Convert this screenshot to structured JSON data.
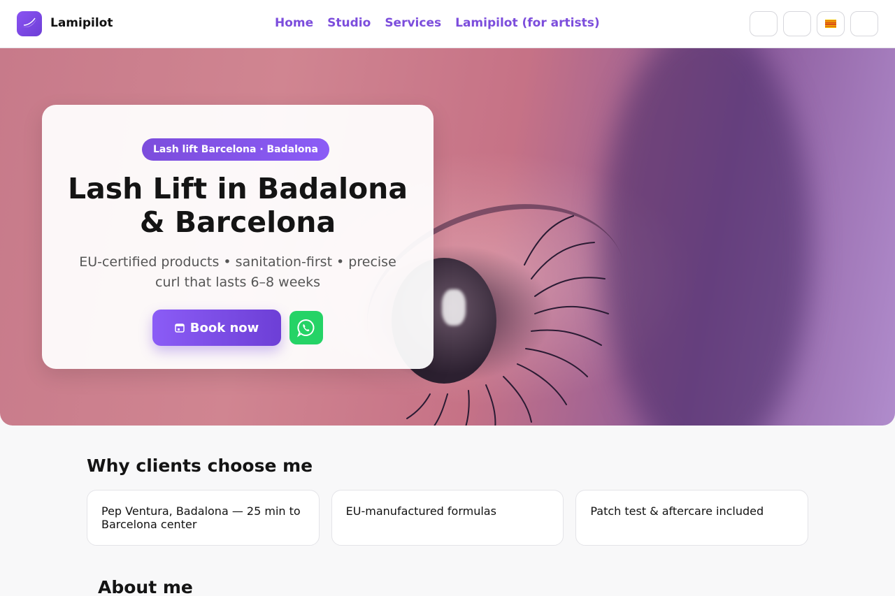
{
  "header": {
    "brand": "Lamipilot",
    "nav": [
      "Home",
      "Studio",
      "Services",
      "Lamipilot (for artists)"
    ],
    "lang_buttons": [
      "",
      "",
      "",
      ""
    ]
  },
  "hero": {
    "badge": "Lash lift Barcelona · Badalona",
    "title": "Lash Lift in Badalona & Barcelona",
    "subtitle": "EU-certified products • sanitation-first • precise curl that lasts 6–8 weeks",
    "book_label": "Book now",
    "book_icon": "calendar-icon",
    "whatsapp_icon": "whatsapp-icon"
  },
  "why": {
    "title": "Why clients choose me",
    "features": [
      "Pep Ventura, Badalona — 25 min to Barcelona center",
      "EU-manufactured formulas",
      "Patch test & aftercare included"
    ]
  },
  "about": {
    "title": "About me"
  },
  "colors": {
    "accent": "#7c4ddc",
    "whatsapp": "#25d366",
    "background": "#f8f8f9"
  }
}
